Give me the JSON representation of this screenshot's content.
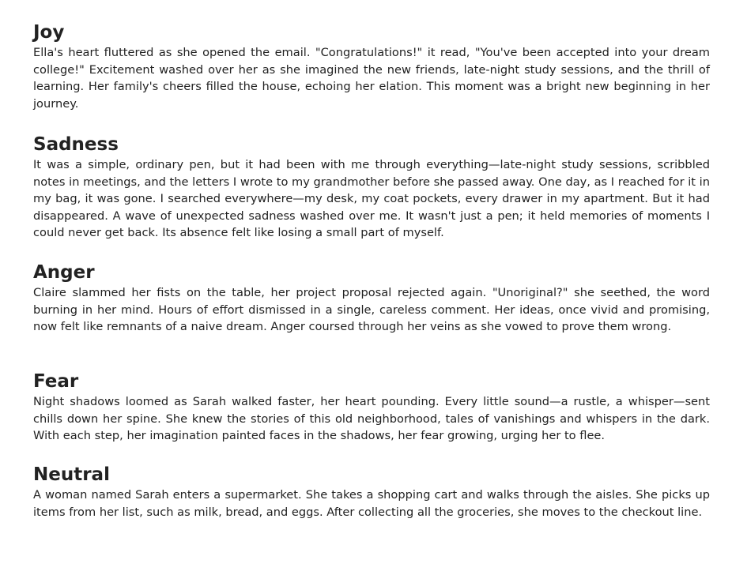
{
  "sections": [
    {
      "heading": "Joy",
      "text": "Ella's heart fluttered as she opened the email. \"Congratulations!\" it read, \"You've been accepted into your dream college!\" Excitement washed over her as she imagined the new friends, late-night study sessions, and the thrill of learning. Her family's cheers filled the house, echoing her elation. This moment was a bright new beginning in her journey."
    },
    {
      "heading": "Sadness",
      "text": " It was a simple, ordinary pen, but it had been with me through everything—late-night study sessions, scribbled notes in meetings, and the letters I wrote to my grandmother before she passed away. One day, as I reached for it in my bag, it was gone. I searched everywhere—my desk, my coat pockets, every drawer in my apartment. But it had disappeared. A wave of unexpected sadness washed over me. It wasn't just a pen; it held memories of moments I could never get back. Its absence felt like losing a small part of myself."
    },
    {
      "heading": "Anger",
      "text": "Claire slammed her fists on the table, her project proposal rejected again. \"Unoriginal?\" she seethed, the word burning in her mind. Hours of effort dismissed in a single, careless comment. Her ideas, once vivid and promising, now felt like remnants of a naive dream. Anger coursed through her veins as she vowed to prove them wrong."
    },
    {
      "heading": "Fear",
      "text": "Night shadows loomed as Sarah walked faster, her heart pounding. Every little sound—a rustle, a whisper—sent chills down her spine. She knew the stories of this old neighborhood, tales of vanishings and whispers in the dark. With each step, her imagination painted faces in the shadows, her fear growing, urging her to flee."
    },
    {
      "heading": "Neutral",
      "text": "A woman named Sarah enters a supermarket. She takes a shopping cart and walks through the aisles. She picks up items from her list, such as milk, bread, and eggs. After collecting all the groceries, she moves to the checkout line."
    }
  ]
}
